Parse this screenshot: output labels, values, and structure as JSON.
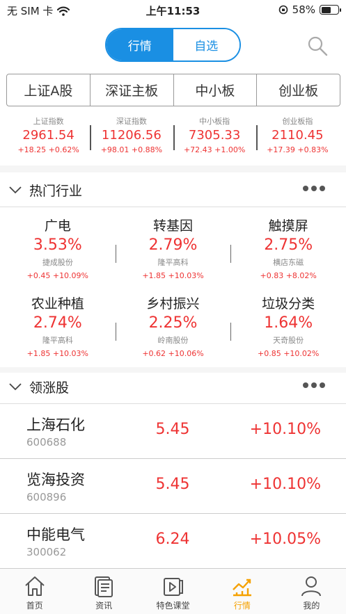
{
  "status_bar": {
    "carrier": "无 SIM 卡",
    "time": "上午11:53",
    "battery": "58%",
    "battery_level": 0.58
  },
  "toggle": {
    "market": "行情",
    "watchlist": "自选"
  },
  "index_tabs": [
    "上证A股",
    "深证主板",
    "中小板",
    "创业板"
  ],
  "indices": [
    {
      "name": "上证指数",
      "value": "2961.54",
      "change": "+18.25 +0.62%"
    },
    {
      "name": "深证指数",
      "value": "11206.56",
      "change": "+98.01 +0.88%"
    },
    {
      "name": "中小板指",
      "value": "7305.33",
      "change": "+72.43 +1.00%"
    },
    {
      "name": "创业板指",
      "value": "2110.45",
      "change": "+17.39 +0.83%"
    }
  ],
  "hot_industry": {
    "title": "热门行业",
    "items": [
      {
        "name": "广电",
        "pct": "3.53%",
        "stock": "捷成股份",
        "change": "+0.45 +10.09%"
      },
      {
        "name": "转基因",
        "pct": "2.79%",
        "stock": "隆平高科",
        "change": "+1.85 +10.03%"
      },
      {
        "name": "触摸屏",
        "pct": "2.75%",
        "stock": "横店东磁",
        "change": "+0.83 +8.02%"
      },
      {
        "name": "农业种植",
        "pct": "2.74%",
        "stock": "隆平高科",
        "change": "+1.85 +10.03%"
      },
      {
        "name": "乡村振兴",
        "pct": "2.25%",
        "stock": "岭南股份",
        "change": "+0.62 +10.06%"
      },
      {
        "name": "垃圾分类",
        "pct": "1.64%",
        "stock": "天奇股份",
        "change": "+0.85 +10.02%"
      }
    ]
  },
  "leading_stocks": {
    "title": "领涨股",
    "rows": [
      {
        "name": "上海石化",
        "code": "600688",
        "price": "5.45",
        "pct": "+10.10%"
      },
      {
        "name": "览海投资",
        "code": "600896",
        "price": "5.45",
        "pct": "+10.10%"
      },
      {
        "name": "中能电气",
        "code": "300062",
        "price": "6.24",
        "pct": "+10.05%"
      }
    ]
  },
  "tabbar": [
    {
      "label": "首页",
      "icon": "home-icon"
    },
    {
      "label": "资讯",
      "icon": "news-icon"
    },
    {
      "label": "特色课堂",
      "icon": "video-icon"
    },
    {
      "label": "行情",
      "icon": "chart-icon"
    },
    {
      "label": "我的",
      "icon": "profile-icon"
    }
  ],
  "colors": {
    "accent": "#1a8fe3",
    "up": "#e33333",
    "active_tab": "#f5a100"
  }
}
